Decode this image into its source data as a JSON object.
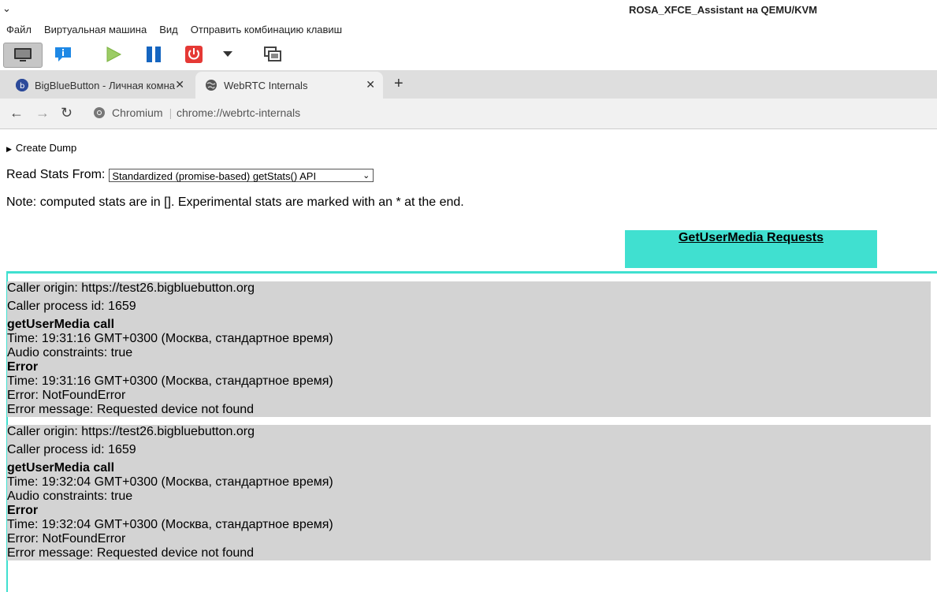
{
  "window": {
    "title": "ROSA_XFCE_Assistant на QEMU/KVM"
  },
  "menu": [
    "Файл",
    "Виртуальная машина",
    "Вид",
    "Отправить комбинацию клавиш"
  ],
  "browser": {
    "tabs": [
      {
        "label": "BigBlueButton - Личная комна",
        "active": false
      },
      {
        "label": "WebRTC Internals",
        "active": true
      }
    ],
    "site_label": "Chromium",
    "url": "chrome://webrtc-internals"
  },
  "page": {
    "create_dump": "Create Dump",
    "read_stats_label": "Read Stats From:",
    "read_stats_value": "Standardized (promise-based) getStats() API",
    "note": "Note: computed stats are in []. Experimental stats are marked with an * at the end.",
    "gum_tab": "GetUserMedia Requests",
    "requests": [
      {
        "origin": "Caller origin: https://test26.bigbluebutton.org",
        "pid": "Caller process id: 1659",
        "call_title": "getUserMedia call",
        "call_time": "Time: 19:31:16 GMT+0300 (Москва, стандартное время)",
        "audio": "Audio constraints: true",
        "error_title": "Error",
        "error_time": "Time: 19:31:16 GMT+0300 (Москва, стандартное время)",
        "error_name": "Error: NotFoundError",
        "error_message": "Error message: Requested device not found"
      },
      {
        "origin": "Caller origin: https://test26.bigbluebutton.org",
        "pid": "Caller process id: 1659",
        "call_title": "getUserMedia call",
        "call_time": "Time: 19:32:04 GMT+0300 (Москва, стандартное время)",
        "audio": "Audio constraints: true",
        "error_title": "Error",
        "error_time": "Time: 19:32:04 GMT+0300 (Москва, стандартное время)",
        "error_name": "Error: NotFoundError",
        "error_message": "Error message: Requested device not found"
      }
    ]
  },
  "colors": {
    "accent": "#40e0d0",
    "request_bg": "#d3d3d3"
  }
}
